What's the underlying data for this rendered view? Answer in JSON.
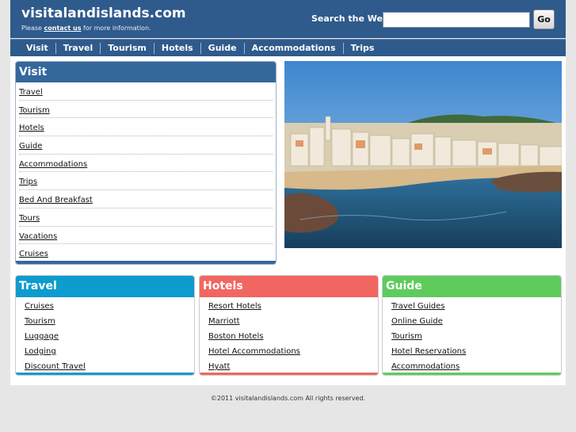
{
  "header": {
    "site_title": "visitalandislands.com",
    "subline_prefix": "Please ",
    "contact_link": "contact us",
    "subline_suffix": " for more information.",
    "search_label": "Search the Web:",
    "search_value": "",
    "go_label": "Go"
  },
  "nav": [
    "Visit",
    "Travel",
    "Tourism",
    "Hotels",
    "Guide",
    "Accommodations",
    "Trips"
  ],
  "visit_box": {
    "title": "Visit",
    "color": "#34679c",
    "links": [
      "Travel",
      "Tourism",
      "Hotels",
      "Guide",
      "Accommodations",
      "Trips",
      "Bed And Breakfast",
      "Tours",
      "Vacations",
      "Cruises"
    ]
  },
  "hero_image": "coastal-town-beach-photo",
  "categories": [
    {
      "title": "Travel",
      "color": "#0e9bce",
      "links": [
        "Cruises",
        "Tourism",
        "Luggage",
        "Lodging",
        "Discount Travel"
      ]
    },
    {
      "title": "Hotels",
      "color": "#f26661",
      "links": [
        "Resort Hotels",
        "Marriott",
        "Boston Hotels",
        "Hotel Accommodations",
        "Hyatt"
      ]
    },
    {
      "title": "Guide",
      "color": "#5fcb5d",
      "links": [
        "Travel Guides",
        "Online Guide",
        "Tourism",
        "Hotel Reservations",
        "Accommodations"
      ]
    }
  ],
  "footer": {
    "text": "©2011 visitalandislands.com All rights reserved."
  }
}
